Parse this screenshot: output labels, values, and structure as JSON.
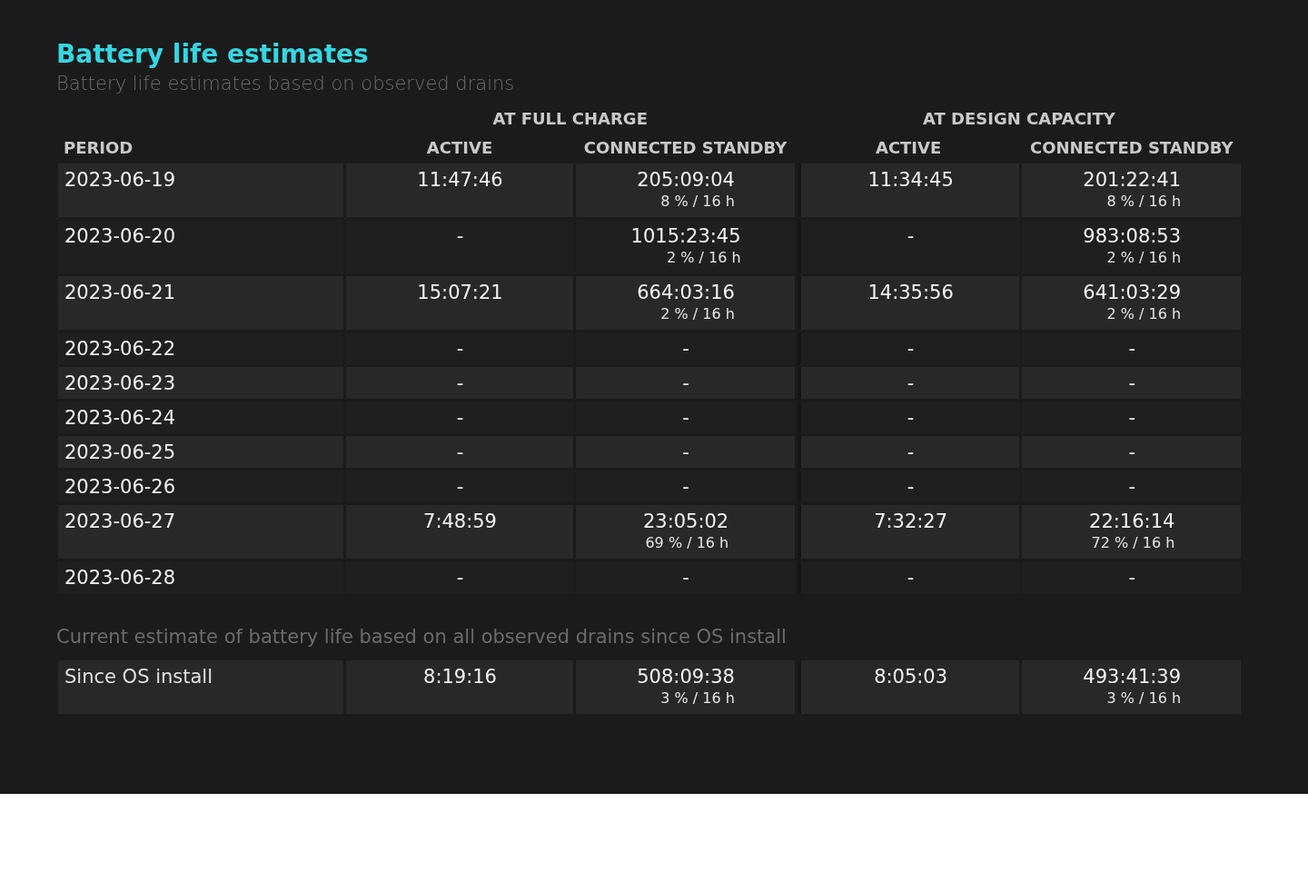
{
  "title": "Battery life estimates",
  "subtitle": "Battery life estimates based on observed drains",
  "table": {
    "group_headers": [
      {
        "label": "AT FULL CHARGE"
      },
      {
        "label": "AT DESIGN CAPACITY"
      }
    ],
    "columns": [
      "PERIOD",
      "ACTIVE",
      "CONNECTED STANDBY",
      "ACTIVE",
      "CONNECTED STANDBY"
    ],
    "rows": [
      {
        "cells": [
          {
            "value": "2023-06-19"
          },
          {
            "value": "11:47:46"
          },
          {
            "value": "205:09:04",
            "rate": "8 % / 16 h"
          },
          {
            "value": "11:34:45"
          },
          {
            "value": "201:22:41",
            "rate": "8 % / 16 h"
          }
        ]
      },
      {
        "cells": [
          {
            "value": "2023-06-20"
          },
          {
            "value": "-"
          },
          {
            "value": "1015:23:45",
            "rate": "2 % / 16 h"
          },
          {
            "value": "-"
          },
          {
            "value": "983:08:53",
            "rate": "2 % / 16 h"
          }
        ]
      },
      {
        "cells": [
          {
            "value": "2023-06-21"
          },
          {
            "value": "15:07:21"
          },
          {
            "value": "664:03:16",
            "rate": "2 % / 16 h"
          },
          {
            "value": "14:35:56"
          },
          {
            "value": "641:03:29",
            "rate": "2 % / 16 h"
          }
        ]
      },
      {
        "cells": [
          {
            "value": "2023-06-22"
          },
          {
            "value": "-"
          },
          {
            "value": "-"
          },
          {
            "value": "-"
          },
          {
            "value": "-"
          }
        ]
      },
      {
        "cells": [
          {
            "value": "2023-06-23"
          },
          {
            "value": "-"
          },
          {
            "value": "-"
          },
          {
            "value": "-"
          },
          {
            "value": "-"
          }
        ]
      },
      {
        "cells": [
          {
            "value": "2023-06-24"
          },
          {
            "value": "-"
          },
          {
            "value": "-"
          },
          {
            "value": "-"
          },
          {
            "value": "-"
          }
        ]
      },
      {
        "cells": [
          {
            "value": "2023-06-25"
          },
          {
            "value": "-"
          },
          {
            "value": "-"
          },
          {
            "value": "-"
          },
          {
            "value": "-"
          }
        ]
      },
      {
        "cells": [
          {
            "value": "2023-06-26"
          },
          {
            "value": "-"
          },
          {
            "value": "-"
          },
          {
            "value": "-"
          },
          {
            "value": "-"
          }
        ]
      },
      {
        "cells": [
          {
            "value": "2023-06-27"
          },
          {
            "value": "7:48:59"
          },
          {
            "value": "23:05:02",
            "rate": "69 % / 16 h"
          },
          {
            "value": "7:32:27"
          },
          {
            "value": "22:16:14",
            "rate": "72 % / 16 h"
          }
        ]
      },
      {
        "cells": [
          {
            "value": "2023-06-28"
          },
          {
            "value": "-"
          },
          {
            "value": "-"
          },
          {
            "value": "-"
          },
          {
            "value": "-"
          }
        ]
      }
    ]
  },
  "summary": {
    "caption": "Current estimate of battery life based on all observed drains since OS install",
    "rows": [
      {
        "cells": [
          {
            "value": "Since OS install"
          },
          {
            "value": "8:19:16"
          },
          {
            "value": "508:09:38",
            "rate": "3 % / 16 h"
          },
          {
            "value": "8:05:03"
          },
          {
            "value": "493:41:39",
            "rate": "3 % / 16 h"
          }
        ]
      }
    ]
  }
}
